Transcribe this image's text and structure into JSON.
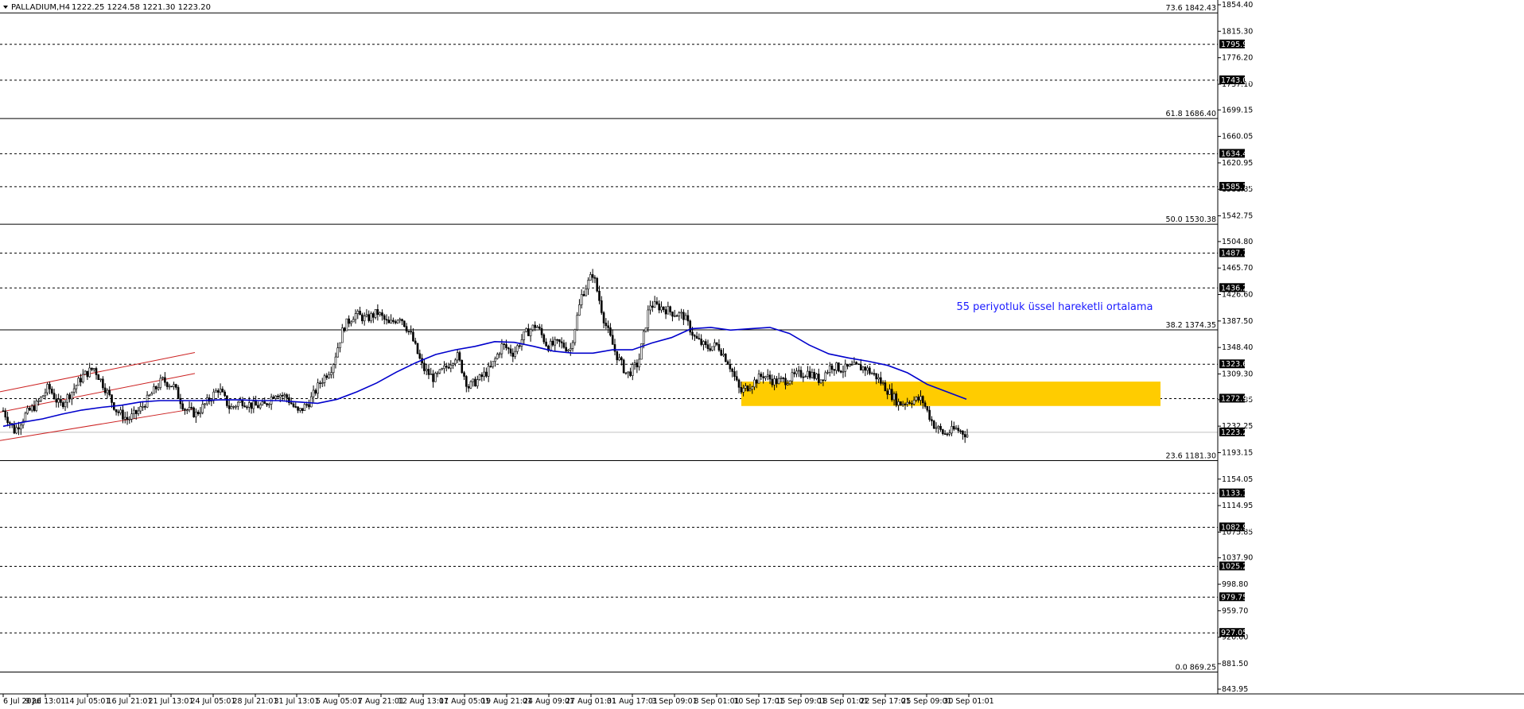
{
  "window": {
    "symbol_title": "PALLADIUM,H4",
    "ohlc": "1222.25 1224.58 1221.30 1223.20"
  },
  "colors": {
    "background": "#ffffff",
    "candle": "#000000",
    "ema": "#0000cc",
    "channel": "#cc2222",
    "zone": "#ffcc00",
    "annotation": "#1a1aff",
    "price_tag_bg": "#000000"
  },
  "chart_data": {
    "type": "candlestick",
    "timeframe": "H4",
    "ylim": [
      843.95,
      1854.4
    ],
    "y_ticks": [
      "1854.40",
      "1815.30",
      "1776.20",
      "1737.10",
      "1699.15",
      "1660.05",
      "1620.95",
      "1581.85",
      "1542.75",
      "1504.80",
      "1465.70",
      "1426.60",
      "1387.50",
      "1348.40",
      "1309.30",
      "1271.35",
      "1232.25",
      "1193.15",
      "1154.05",
      "1114.95",
      "1075.85",
      "1037.90",
      "998.80",
      "959.70",
      "920.60",
      "881.50",
      "843.95"
    ],
    "x_ticks": [
      "6 Jul 2026",
      "9 Jul 13:01",
      "14 Jul 05:01",
      "16 Jul 21:01",
      "21 Jul 13:01",
      "24 Jul 05:01",
      "28 Jul 21:01",
      "31 Jul 13:01",
      "5 Aug 05:01",
      "7 Aug 21:01",
      "12 Aug 13:01",
      "17 Aug 05:01",
      "19 Aug 21:01",
      "24 Aug 09:01",
      "27 Aug 01:01",
      "31 Aug 17:01",
      "3 Sep 09:01",
      "8 Sep 01:01",
      "10 Sep 17:01",
      "15 Sep 09:01",
      "18 Sep 01:01",
      "22 Sep 17:01",
      "25 Sep 09:01",
      "30 Sep 01:01"
    ],
    "current_price": "1223.20",
    "horizontal_levels": [
      "1795.95",
      "1743.00",
      "1634.45",
      "1585.75",
      "1487.75",
      "1436.25",
      "1323.65",
      "1272.95",
      "1133.10",
      "1082.90",
      "1025.25",
      "979.75",
      "927.05"
    ],
    "fibonacci": [
      {
        "label": "73.6 1842.43",
        "value": 1842.43
      },
      {
        "label": "61.8 1686.40",
        "value": 1686.4
      },
      {
        "label": "50.0 1530.38",
        "value": 1530.38
      },
      {
        "label": "38.2 1374.35",
        "value": 1374.35
      },
      {
        "label": "23.6 1181.30",
        "value": 1181.3
      },
      {
        "label": "0.0 869.25",
        "value": 869.25
      }
    ],
    "ema_period": 55,
    "ema_values": [
      1232,
      1238,
      1243,
      1250,
      1256,
      1260,
      1263,
      1268,
      1270,
      1270,
      1270,
      1271,
      1271,
      1270,
      1270,
      1268,
      1266,
      1272,
      1283,
      1296,
      1312,
      1326,
      1338,
      1345,
      1350,
      1357,
      1356,
      1350,
      1343,
      1340,
      1340,
      1345,
      1345,
      1355,
      1363,
      1376,
      1378,
      1374,
      1376,
      1378,
      1369,
      1352,
      1339,
      1333,
      1328,
      1322,
      1311,
      1294,
      1283,
      1272
    ],
    "price_path": [
      1255,
      1225,
      1250,
      1265,
      1290,
      1262,
      1282,
      1306,
      1318,
      1288,
      1255,
      1242,
      1255,
      1278,
      1300,
      1292,
      1258,
      1250,
      1268,
      1288,
      1258,
      1270,
      1262,
      1262,
      1282,
      1275,
      1252,
      1268,
      1298,
      1320,
      1378,
      1398,
      1390,
      1400,
      1382,
      1395,
      1365,
      1318,
      1302,
      1318,
      1338,
      1290,
      1302,
      1318,
      1352,
      1340,
      1368,
      1382,
      1350,
      1355,
      1345,
      1425,
      1458,
      1388,
      1340,
      1308,
      1325,
      1412,
      1408,
      1400,
      1395,
      1362,
      1348,
      1352,
      1325,
      1282,
      1295,
      1308,
      1298,
      1300,
      1308,
      1312,
      1300,
      1322,
      1316,
      1320,
      1318,
      1305,
      1285,
      1265,
      1270,
      1272,
      1235,
      1220,
      1228,
      1220
    ],
    "channel": {
      "lower": [
        1211,
        1258
      ],
      "mid": [
        1253,
        1310
      ],
      "upper": [
        1283,
        1341
      ]
    },
    "zone": {
      "top": 1298,
      "bottom": 1262
    }
  },
  "annotation": {
    "ema_label": "55 periyotluk üssel hareketli ortalama"
  }
}
